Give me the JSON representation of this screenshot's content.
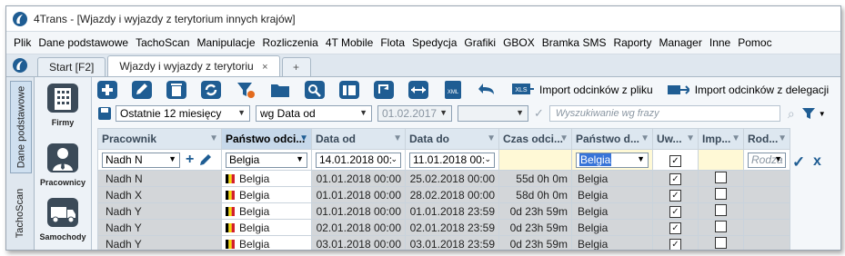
{
  "window": {
    "title": "4Trans - [Wjazdy i wyjazdy z terytorium innych krajów]"
  },
  "menu": [
    "Plik",
    "Dane podstawowe",
    "TachoScan",
    "Manipulacje",
    "Rozliczenia",
    "4T Mobile",
    "Flota",
    "Spedycja",
    "Grafiki",
    "GBOX",
    "Bramka SMS",
    "Raporty",
    "Manager",
    "Inne",
    "Pomoc"
  ],
  "tabs": {
    "start": "Start [F2]",
    "active": "Wjazdy i wyjazdy z terytoriu",
    "close": "×",
    "new": "+"
  },
  "sidebar": {
    "groups": [
      "Dane podstawowe",
      "TachoScan"
    ],
    "items": [
      "Firmy",
      "Pracownicy",
      "Samochody"
    ]
  },
  "toolbar": {
    "import_excel": "Import odcinków z pliku",
    "import_delegation": "Import odcinków z delegacji"
  },
  "filters": {
    "period": "Ostatnie 12 miesięcy",
    "date_type": "wg Data od",
    "date_value": "01.02.2017",
    "search_placeholder": "Wyszukiwanie wg frazy"
  },
  "columns": [
    "Pracownik",
    "Państwo odci...",
    "Data od",
    "Data do",
    "Czas odci...",
    "Państwo d...",
    "Uw...",
    "Imp...",
    "Rod..."
  ],
  "edit_row": {
    "employee": "Nadh N",
    "country": "Belgia",
    "date_from": "14.01.2018 00:",
    "date_to": "11.01.2018 00:",
    "country_to": "Belgia",
    "type_placeholder": "Rodza",
    "accept": "✓",
    "cancel": "x"
  },
  "rows": [
    {
      "employee": "Nadh N",
      "country": "Belgia",
      "from": "01.01.2018 00:00",
      "to": "25.02.2018 00:00",
      "duration": "55d 0h 0m",
      "country_to": "Belgia",
      "uw": true,
      "imp": false
    },
    {
      "employee": "Nadh X",
      "country": "Belgia",
      "from": "01.01.2018 00:00",
      "to": "28.02.2018 00:00",
      "duration": "58d 0h 0m",
      "country_to": "Belgia",
      "uw": true,
      "imp": false
    },
    {
      "employee": "Nadh Y",
      "country": "Belgia",
      "from": "01.01.2018 00:00",
      "to": "01.01.2018 23:59",
      "duration": "0d 23h 59m",
      "country_to": "Belgia",
      "uw": true,
      "imp": false
    },
    {
      "employee": "Nadh Y",
      "country": "Belgia",
      "from": "02.01.2018 00:00",
      "to": "02.01.2018 23:59",
      "duration": "0d 23h 59m",
      "country_to": "Belgia",
      "uw": true,
      "imp": false
    },
    {
      "employee": "Nadh Y",
      "country": "Belgia",
      "from": "03.01.2018 00:00",
      "to": "03.01.2018 23:59",
      "duration": "0d 23h 59m",
      "country_to": "Belgia",
      "uw": true,
      "imp": false
    }
  ],
  "colors": {
    "accent": "#1f5d93",
    "header_highlight": "#c6d8ea",
    "row_selected": "#d3d6d9",
    "edit_yellow": "#fff9d6"
  }
}
